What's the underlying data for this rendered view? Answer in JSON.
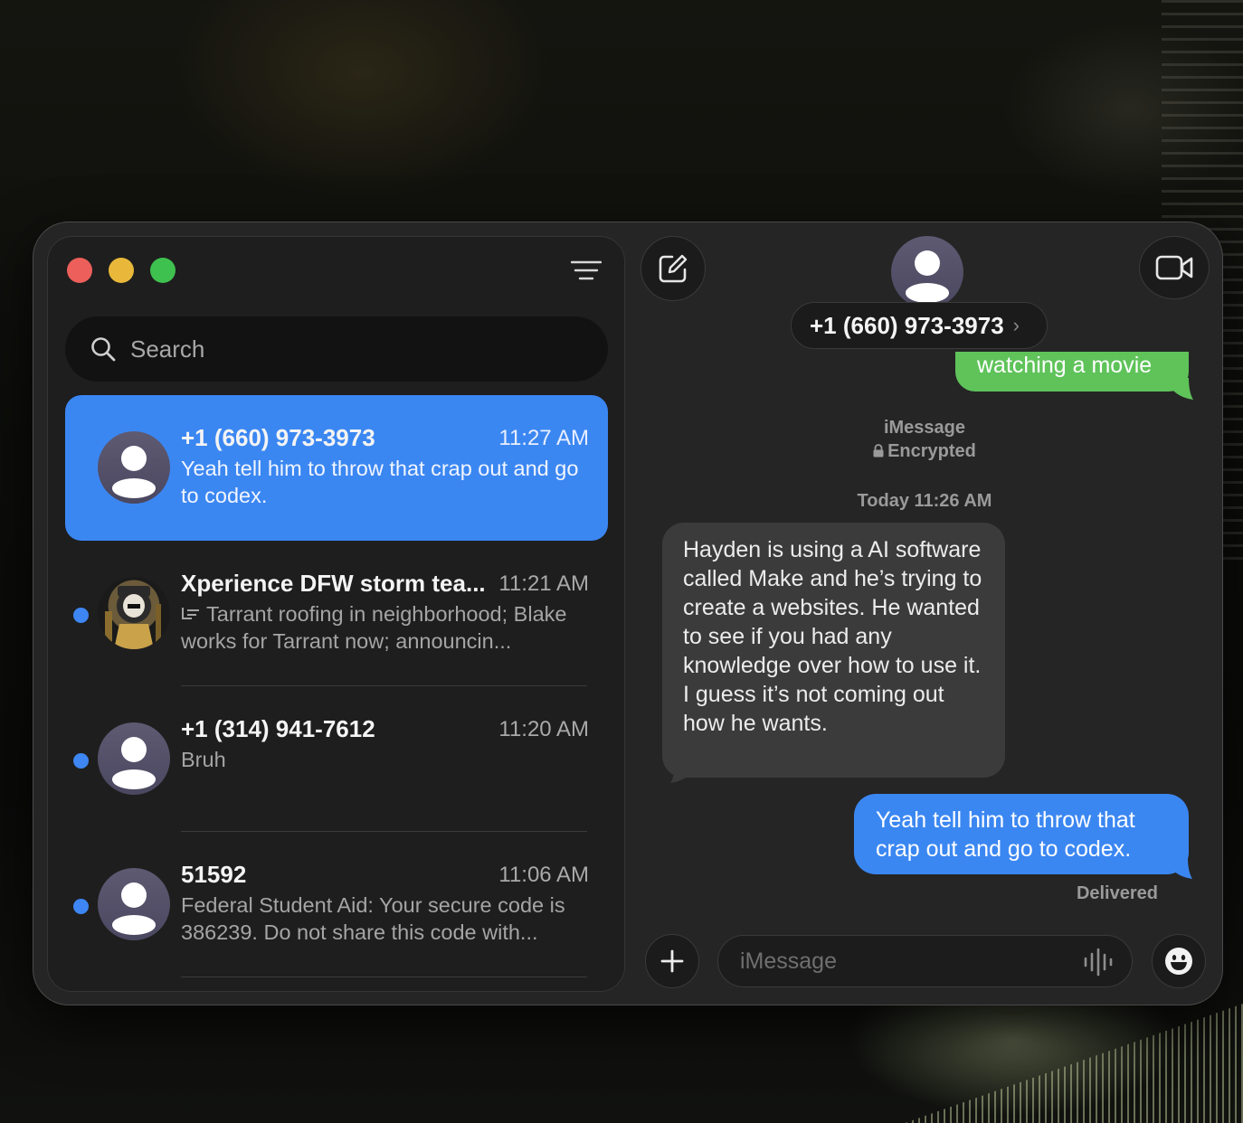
{
  "window": {
    "search": {
      "placeholder": "Search"
    },
    "conversations": [
      {
        "name": "+1 (660) 973-3973",
        "time": "11:27 AM",
        "preview": "Yeah tell him to throw that crap out and go to codex.",
        "unread": false,
        "selected": true
      },
      {
        "name": "Xperience DFW storm tea...",
        "time": "11:21 AM",
        "preview": "Tarrant roofing in neighborhood; Blake works for Tarrant now; announcin...",
        "unread": true,
        "selected": false,
        "reply_icon": "reply-arrow-icon"
      },
      {
        "name": "+1 (314) 941-7612",
        "time": "11:20 AM",
        "preview": "Bruh",
        "unread": true,
        "selected": false
      },
      {
        "name": "51592",
        "time": "11:06 AM",
        "preview": "Federal Student Aid: Your secure code is 386239. Do not share this code with...",
        "unread": true,
        "selected": false
      }
    ]
  },
  "conversation": {
    "contact": "+1 (660) 973-3973",
    "messages": {
      "previous_out": "watching a movie",
      "service": "iMessage",
      "encryption": "Encrypted",
      "timestamp": "Today 11:26 AM",
      "incoming": "Hayden is using a AI software called Make and he’s trying to create a websites. He wanted to see if you had any knowledge over how to use it. I guess it’s not coming out how he wants.",
      "outgoing": "Yeah tell him to throw that crap out and go to codex.",
      "status": "Delivered"
    },
    "composer": {
      "placeholder": "iMessage"
    }
  },
  "colors": {
    "accent_blue": "#3b87f2",
    "sms_green": "#5fc35a",
    "incoming_bubble": "#3b3b3b",
    "unread_dot": "#3d86f3",
    "close": "#ec5f5a",
    "minimize": "#e9b83a",
    "maximize": "#3fc14f"
  },
  "icons": [
    "filter-icon",
    "search-icon",
    "compose-icon",
    "video-call-icon",
    "plus-icon",
    "waveform-icon",
    "emoji-icon",
    "contact-silhouette-icon",
    "lock-icon",
    "chevron-right-icon"
  ]
}
